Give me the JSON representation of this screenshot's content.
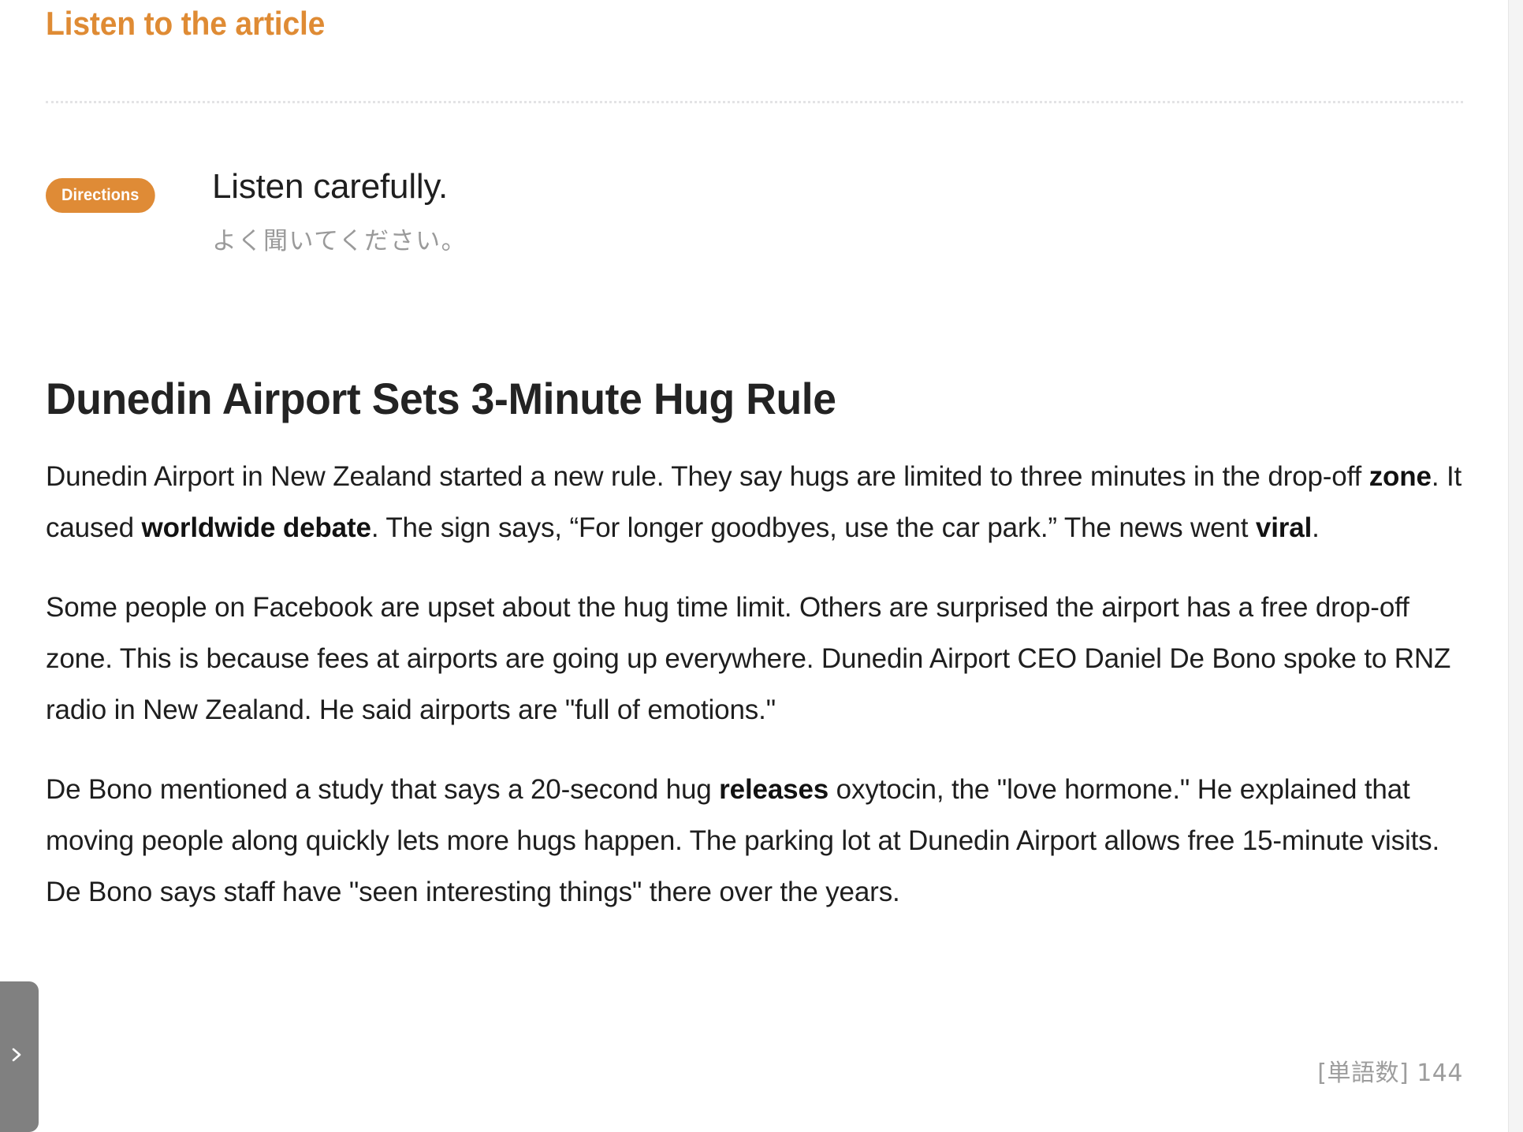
{
  "page": {
    "background": "#ffffff",
    "accent_color": "#df8b35",
    "body_text_color": "#1e1e1e",
    "muted_text_color": "#9a9a9a"
  },
  "section": {
    "heading": "Listen to the article"
  },
  "directions": {
    "badge_label": "Directions",
    "badge_color": "#df8b36",
    "instruction_en": "Listen carefully.",
    "instruction_ja": "よく聞いてください。"
  },
  "article": {
    "title": "Dunedin Airport Sets 3-Minute Hug Rule",
    "paragraphs": [
      {
        "id": "p1",
        "runs": [
          {
            "text": "Dunedin Airport in New Zealand started a new rule. They say hugs are limited to three minutes in the drop-off ",
            "bold": false
          },
          {
            "text": "zone",
            "bold": true
          },
          {
            "text": ". It caused ",
            "bold": false
          },
          {
            "text": "worldwide debate",
            "bold": true
          },
          {
            "text": ". The sign says, “For longer goodbyes, use the car park.” The news went ",
            "bold": false
          },
          {
            "text": "viral",
            "bold": true
          },
          {
            "text": ".",
            "bold": false
          }
        ]
      },
      {
        "id": "p2",
        "runs": [
          {
            "text": "Some people on Facebook are upset about the hug time limit. Others are surprised the airport has a free drop-off zone. This is because fees at airports are going up everywhere. Dunedin Airport CEO Daniel De Bono spoke to RNZ radio in New Zealand. He said airports are \"full of emotions.\"",
            "bold": false
          }
        ]
      },
      {
        "id": "p3",
        "runs": [
          {
            "text": "De Bono mentioned a study that says a 20-second hug ",
            "bold": false
          },
          {
            "text": "releases",
            "bold": true
          },
          {
            "text": " oxytocin, the \"love hormone.\" He explained that moving people along quickly lets more hugs happen. The parking lot at Dunedin Airport allows free 15-minute visits. De Bono says staff have \"seen interesting things\" there over the years.",
            "bold": false
          }
        ]
      }
    ]
  },
  "footer": {
    "word_count_label": "[単語数] 144",
    "word_count_value": 144
  },
  "drawer": {
    "handle_icon": "chevron-right-icon",
    "handle_color": "#808080"
  }
}
